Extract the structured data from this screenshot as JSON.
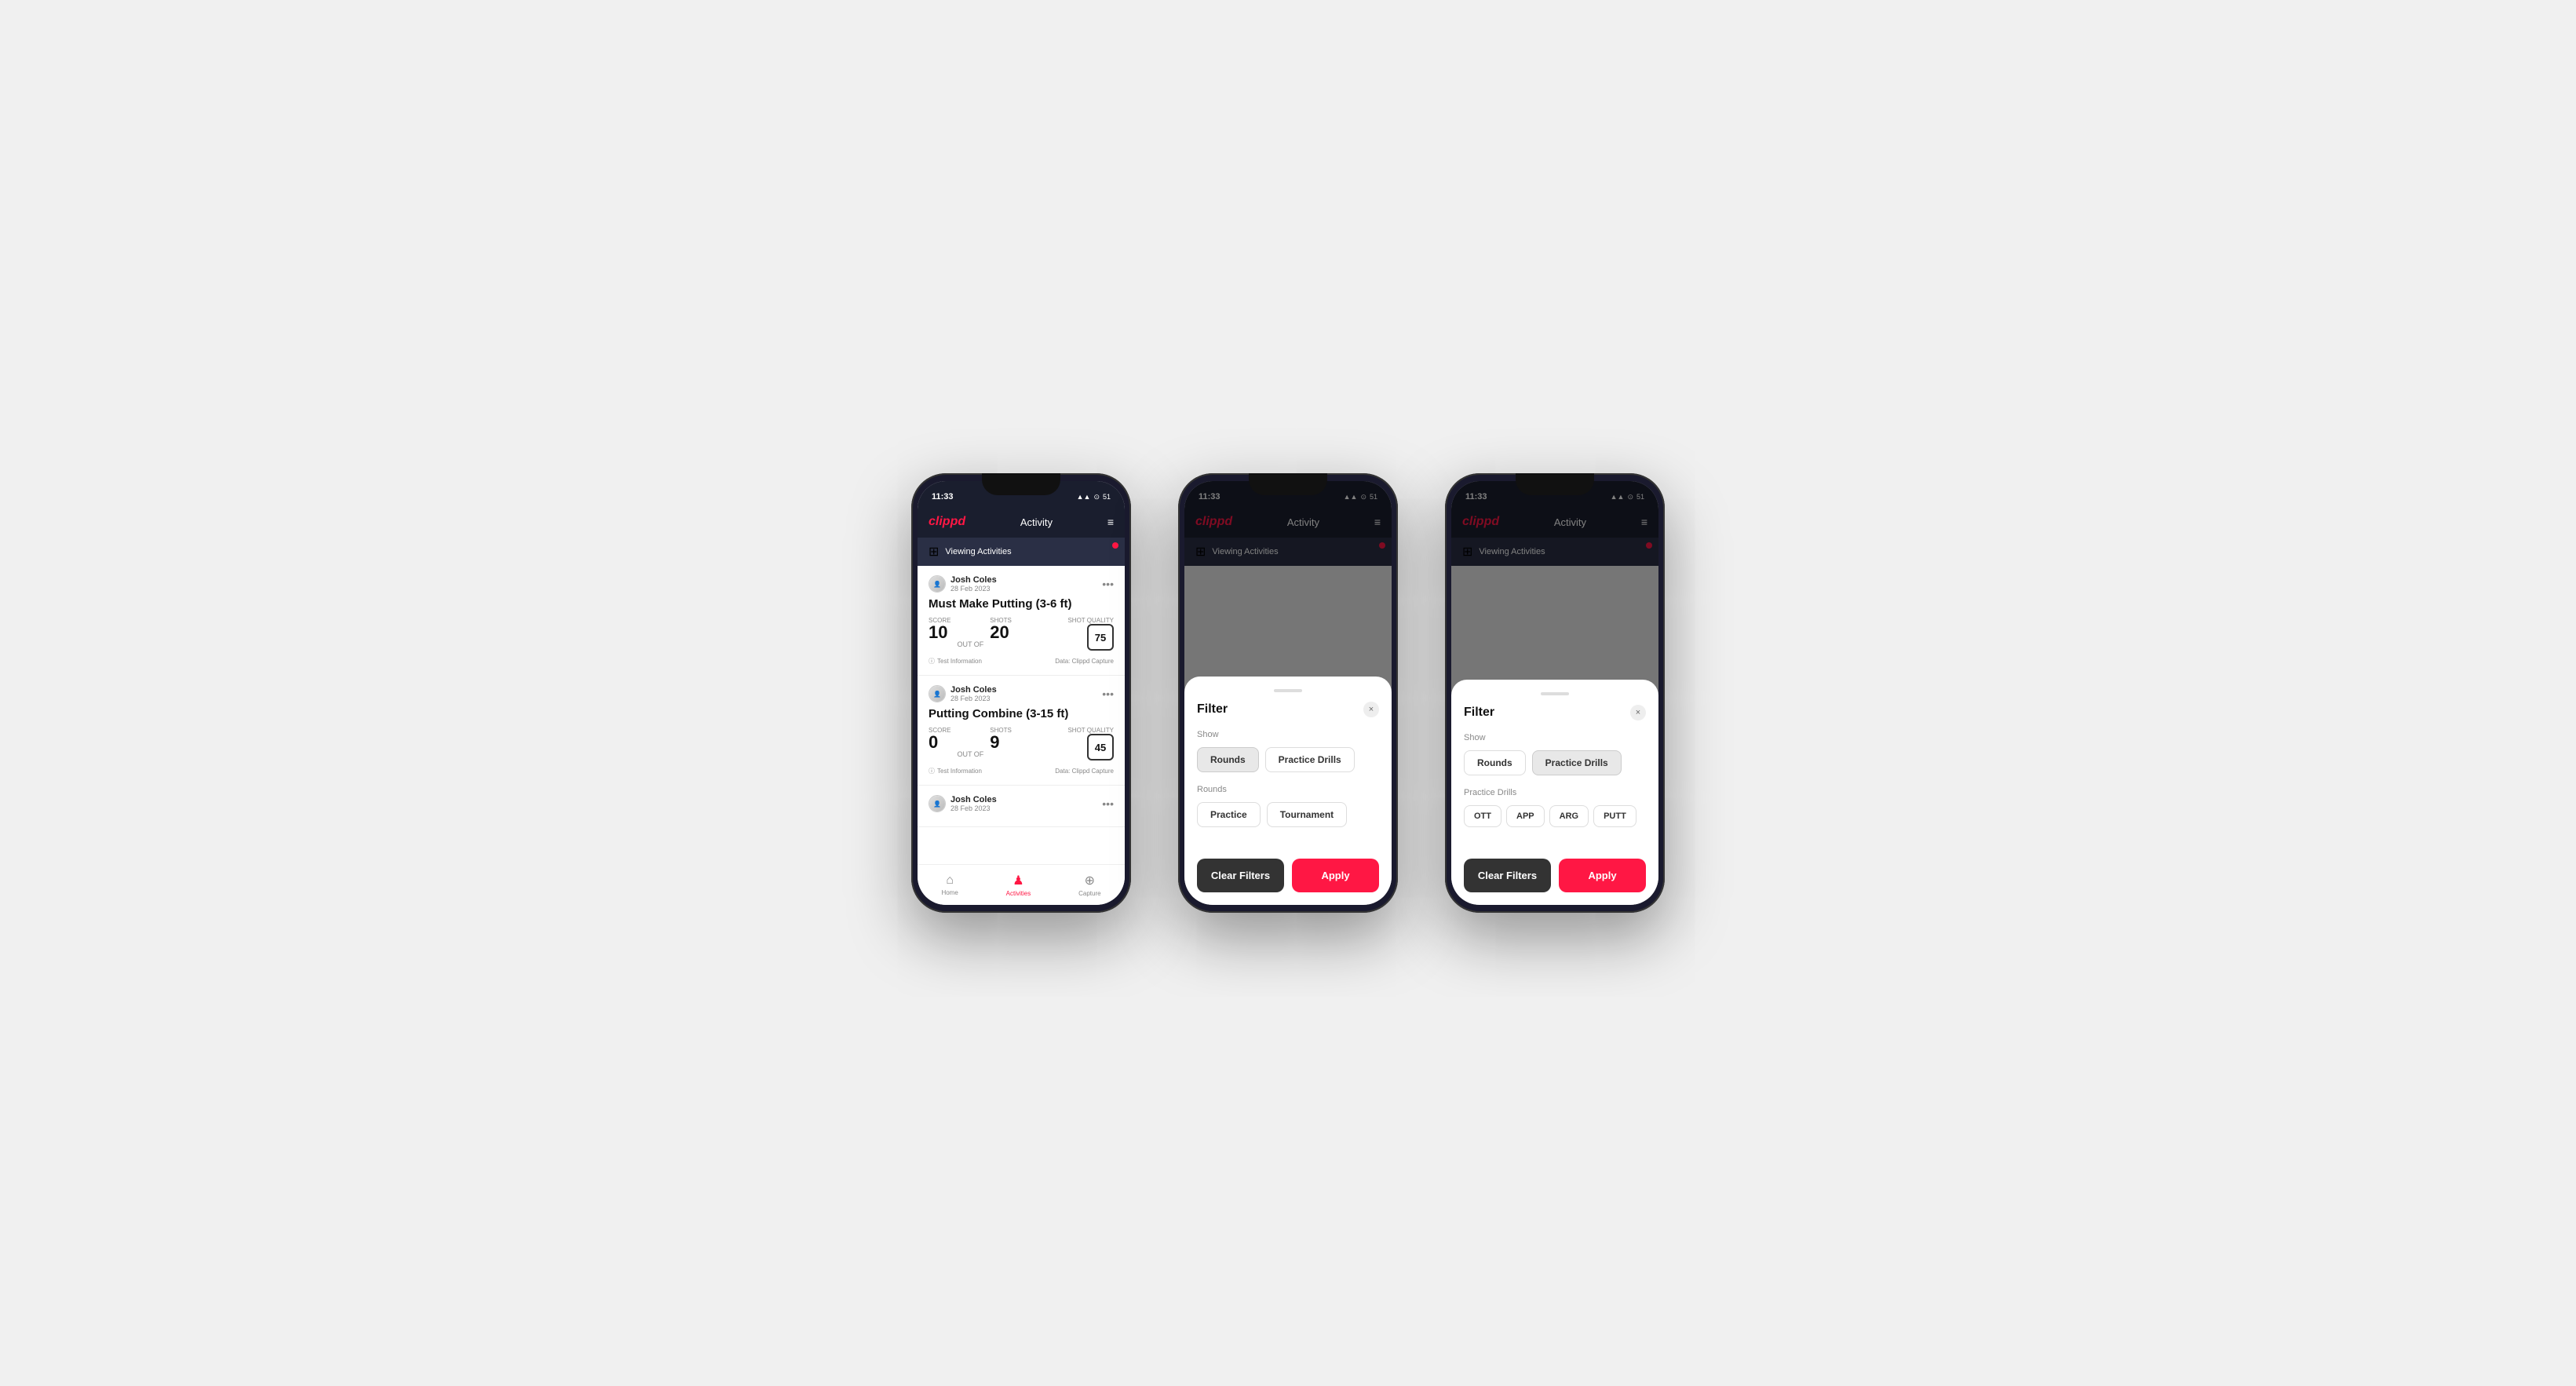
{
  "phones": [
    {
      "id": "phone1",
      "type": "activity-list",
      "statusBar": {
        "time": "11:33",
        "icons": "▲▲ ⊙ 51"
      },
      "header": {
        "logo": "clippd",
        "title": "Activity",
        "menuIcon": "≡"
      },
      "filterBanner": {
        "icon": "⊞",
        "text": "Viewing Activities",
        "hasDot": true
      },
      "activities": [
        {
          "userName": "Josh Coles",
          "date": "28 Feb 2023",
          "title": "Must Make Putting (3-6 ft)",
          "scoreLabel": "Score",
          "scoreValue": "10",
          "outOf": "OUT OF",
          "shotsLabel": "Shots",
          "shotsValue": "20",
          "shotQualityLabel": "Shot Quality",
          "shotQualityValue": "75",
          "testInfo": "Test Information",
          "dataSource": "Data: Clippd Capture"
        },
        {
          "userName": "Josh Coles",
          "date": "28 Feb 2023",
          "title": "Putting Combine (3-15 ft)",
          "scoreLabel": "Score",
          "scoreValue": "0",
          "outOf": "OUT OF",
          "shotsLabel": "Shots",
          "shotsValue": "9",
          "shotQualityLabel": "Shot Quality",
          "shotQualityValue": "45",
          "testInfo": "Test Information",
          "dataSource": "Data: Clippd Capture"
        },
        {
          "userName": "Josh Coles",
          "date": "28 Feb 2023",
          "title": "",
          "scoreLabel": "",
          "scoreValue": "",
          "outOf": "",
          "shotsLabel": "",
          "shotsValue": "",
          "shotQualityLabel": "",
          "shotQualityValue": "",
          "testInfo": "",
          "dataSource": ""
        }
      ],
      "bottomNav": [
        {
          "icon": "⌂",
          "label": "Home",
          "active": false
        },
        {
          "icon": "♟",
          "label": "Activities",
          "active": true
        },
        {
          "icon": "⊕",
          "label": "Capture",
          "active": false
        }
      ]
    },
    {
      "id": "phone2",
      "type": "filter-rounds",
      "statusBar": {
        "time": "11:33",
        "icons": "▲▲ ⊙ 51"
      },
      "header": {
        "logo": "clippd",
        "title": "Activity",
        "menuIcon": "≡"
      },
      "filterBanner": {
        "icon": "⊞",
        "text": "Viewing Activities",
        "hasDot": true
      },
      "modal": {
        "title": "Filter",
        "closeIcon": "×",
        "showLabel": "Show",
        "showButtons": [
          {
            "label": "Rounds",
            "active": true
          },
          {
            "label": "Practice Drills",
            "active": false
          }
        ],
        "roundsLabel": "Rounds",
        "roundsButtons": [
          {
            "label": "Practice",
            "active": false
          },
          {
            "label": "Tournament",
            "active": false
          }
        ],
        "clearFiltersLabel": "Clear Filters",
        "applyLabel": "Apply"
      }
    },
    {
      "id": "phone3",
      "type": "filter-drills",
      "statusBar": {
        "time": "11:33",
        "icons": "▲▲ ⊙ 51"
      },
      "header": {
        "logo": "clippd",
        "title": "Activity",
        "menuIcon": "≡"
      },
      "filterBanner": {
        "icon": "⊞",
        "text": "Viewing Activities",
        "hasDot": true
      },
      "modal": {
        "title": "Filter",
        "closeIcon": "×",
        "showLabel": "Show",
        "showButtons": [
          {
            "label": "Rounds",
            "active": false
          },
          {
            "label": "Practice Drills",
            "active": true
          }
        ],
        "drillsLabel": "Practice Drills",
        "drillTags": [
          {
            "label": "OTT"
          },
          {
            "label": "APP"
          },
          {
            "label": "ARG"
          },
          {
            "label": "PUTT"
          }
        ],
        "clearFiltersLabel": "Clear Filters",
        "applyLabel": "Apply"
      }
    }
  ],
  "colors": {
    "brand": "#ff1744",
    "navBg": "#1a1e2e",
    "filterBg": "#2a2f45",
    "clearBtn": "#333333",
    "applyBtn": "#ff1744"
  }
}
